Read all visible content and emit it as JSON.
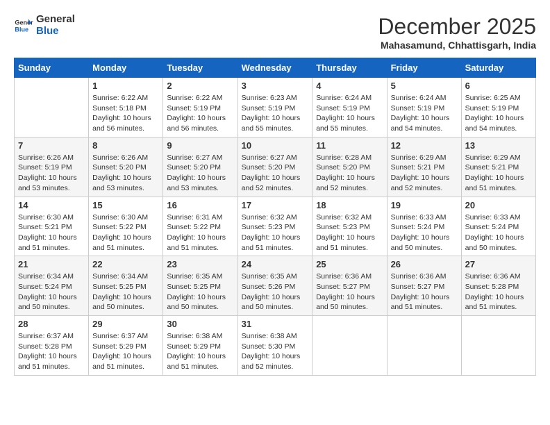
{
  "logo": {
    "line1": "General",
    "line2": "Blue"
  },
  "title": "December 2025",
  "location": "Mahasamund, Chhattisgarh, India",
  "weekdays": [
    "Sunday",
    "Monday",
    "Tuesday",
    "Wednesday",
    "Thursday",
    "Friday",
    "Saturday"
  ],
  "weeks": [
    [
      {
        "day": "",
        "content": ""
      },
      {
        "day": "1",
        "content": "Sunrise: 6:22 AM\nSunset: 5:18 PM\nDaylight: 10 hours\nand 56 minutes."
      },
      {
        "day": "2",
        "content": "Sunrise: 6:22 AM\nSunset: 5:19 PM\nDaylight: 10 hours\nand 56 minutes."
      },
      {
        "day": "3",
        "content": "Sunrise: 6:23 AM\nSunset: 5:19 PM\nDaylight: 10 hours\nand 55 minutes."
      },
      {
        "day": "4",
        "content": "Sunrise: 6:24 AM\nSunset: 5:19 PM\nDaylight: 10 hours\nand 55 minutes."
      },
      {
        "day": "5",
        "content": "Sunrise: 6:24 AM\nSunset: 5:19 PM\nDaylight: 10 hours\nand 54 minutes."
      },
      {
        "day": "6",
        "content": "Sunrise: 6:25 AM\nSunset: 5:19 PM\nDaylight: 10 hours\nand 54 minutes."
      }
    ],
    [
      {
        "day": "7",
        "content": "Sunrise: 6:26 AM\nSunset: 5:19 PM\nDaylight: 10 hours\nand 53 minutes."
      },
      {
        "day": "8",
        "content": "Sunrise: 6:26 AM\nSunset: 5:20 PM\nDaylight: 10 hours\nand 53 minutes."
      },
      {
        "day": "9",
        "content": "Sunrise: 6:27 AM\nSunset: 5:20 PM\nDaylight: 10 hours\nand 53 minutes."
      },
      {
        "day": "10",
        "content": "Sunrise: 6:27 AM\nSunset: 5:20 PM\nDaylight: 10 hours\nand 52 minutes."
      },
      {
        "day": "11",
        "content": "Sunrise: 6:28 AM\nSunset: 5:20 PM\nDaylight: 10 hours\nand 52 minutes."
      },
      {
        "day": "12",
        "content": "Sunrise: 6:29 AM\nSunset: 5:21 PM\nDaylight: 10 hours\nand 52 minutes."
      },
      {
        "day": "13",
        "content": "Sunrise: 6:29 AM\nSunset: 5:21 PM\nDaylight: 10 hours\nand 51 minutes."
      }
    ],
    [
      {
        "day": "14",
        "content": "Sunrise: 6:30 AM\nSunset: 5:21 PM\nDaylight: 10 hours\nand 51 minutes."
      },
      {
        "day": "15",
        "content": "Sunrise: 6:30 AM\nSunset: 5:22 PM\nDaylight: 10 hours\nand 51 minutes."
      },
      {
        "day": "16",
        "content": "Sunrise: 6:31 AM\nSunset: 5:22 PM\nDaylight: 10 hours\nand 51 minutes."
      },
      {
        "day": "17",
        "content": "Sunrise: 6:32 AM\nSunset: 5:23 PM\nDaylight: 10 hours\nand 51 minutes."
      },
      {
        "day": "18",
        "content": "Sunrise: 6:32 AM\nSunset: 5:23 PM\nDaylight: 10 hours\nand 51 minutes."
      },
      {
        "day": "19",
        "content": "Sunrise: 6:33 AM\nSunset: 5:24 PM\nDaylight: 10 hours\nand 50 minutes."
      },
      {
        "day": "20",
        "content": "Sunrise: 6:33 AM\nSunset: 5:24 PM\nDaylight: 10 hours\nand 50 minutes."
      }
    ],
    [
      {
        "day": "21",
        "content": "Sunrise: 6:34 AM\nSunset: 5:24 PM\nDaylight: 10 hours\nand 50 minutes."
      },
      {
        "day": "22",
        "content": "Sunrise: 6:34 AM\nSunset: 5:25 PM\nDaylight: 10 hours\nand 50 minutes."
      },
      {
        "day": "23",
        "content": "Sunrise: 6:35 AM\nSunset: 5:25 PM\nDaylight: 10 hours\nand 50 minutes."
      },
      {
        "day": "24",
        "content": "Sunrise: 6:35 AM\nSunset: 5:26 PM\nDaylight: 10 hours\nand 50 minutes."
      },
      {
        "day": "25",
        "content": "Sunrise: 6:36 AM\nSunset: 5:27 PM\nDaylight: 10 hours\nand 50 minutes."
      },
      {
        "day": "26",
        "content": "Sunrise: 6:36 AM\nSunset: 5:27 PM\nDaylight: 10 hours\nand 51 minutes."
      },
      {
        "day": "27",
        "content": "Sunrise: 6:36 AM\nSunset: 5:28 PM\nDaylight: 10 hours\nand 51 minutes."
      }
    ],
    [
      {
        "day": "28",
        "content": "Sunrise: 6:37 AM\nSunset: 5:28 PM\nDaylight: 10 hours\nand 51 minutes."
      },
      {
        "day": "29",
        "content": "Sunrise: 6:37 AM\nSunset: 5:29 PM\nDaylight: 10 hours\nand 51 minutes."
      },
      {
        "day": "30",
        "content": "Sunrise: 6:38 AM\nSunset: 5:29 PM\nDaylight: 10 hours\nand 51 minutes."
      },
      {
        "day": "31",
        "content": "Sunrise: 6:38 AM\nSunset: 5:30 PM\nDaylight: 10 hours\nand 52 minutes."
      },
      {
        "day": "",
        "content": ""
      },
      {
        "day": "",
        "content": ""
      },
      {
        "day": "",
        "content": ""
      }
    ]
  ]
}
